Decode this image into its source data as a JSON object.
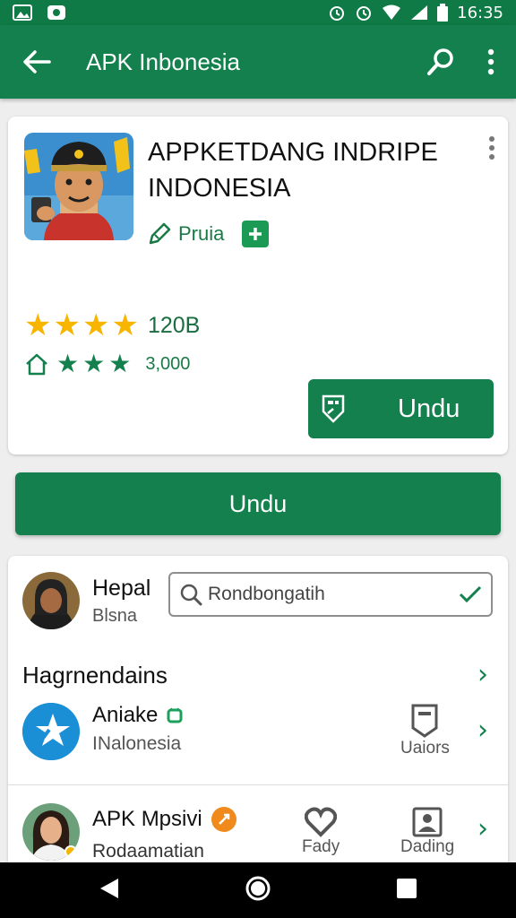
{
  "status_bar": {
    "time": "16:35"
  },
  "app_bar": {
    "title": "APK Inbonesia"
  },
  "app": {
    "title": "APPKETDANG INDRIPE INDONESIA",
    "developer": "Pruia",
    "rating_value": "120B",
    "stars": 4,
    "downloads": "3,000",
    "install_label": "Undu"
  },
  "primary_button": {
    "label": "Undu"
  },
  "profile": {
    "name": "Hepal",
    "subtitle": "Blsna"
  },
  "search": {
    "value": "Rondbongatih"
  },
  "section": {
    "title": "Hagrnendains"
  },
  "list": [
    {
      "title": "Aniake",
      "subtitle": "INalonesia",
      "action_label": "Uaiors"
    },
    {
      "title": "APK Mpsivi",
      "subtitle": "Rodaamatian",
      "action1_label": "Fady",
      "action2_label": "Dading"
    }
  ],
  "colors": {
    "primary": "#13804d",
    "star": "#f7b500",
    "accent_orange": "#f08a1c"
  }
}
